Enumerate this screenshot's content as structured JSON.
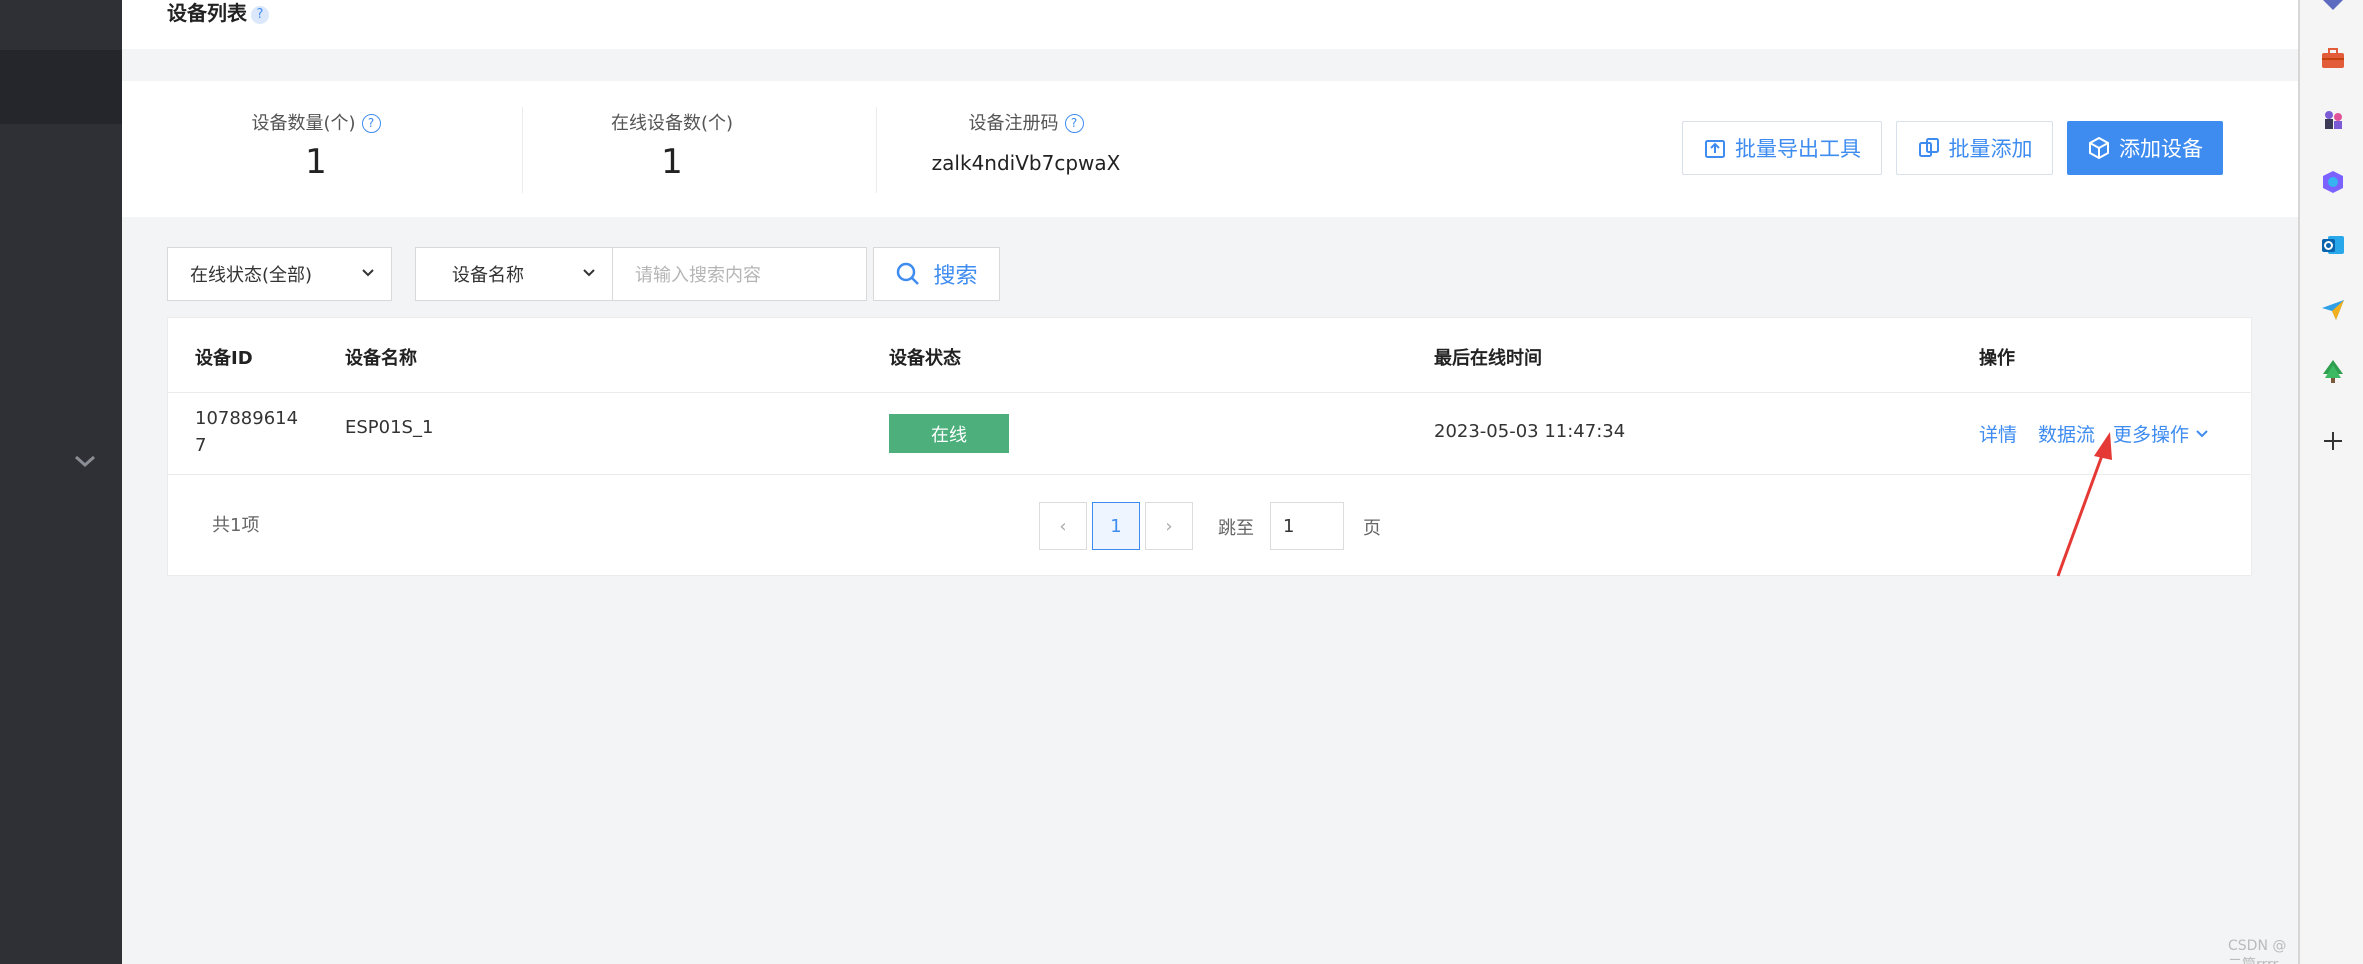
{
  "page": {
    "title": "设备列表",
    "title_help": "?"
  },
  "stats": [
    {
      "label": "设备数量(个)",
      "value": "1",
      "has_help": true
    },
    {
      "label": "在线设备数(个)",
      "value": "1",
      "has_help": false
    },
    {
      "label": "设备注册码",
      "value": "zalk4ndiVb7cpwaX",
      "has_help": true
    }
  ],
  "help_glyph": "?",
  "actions": {
    "export_tool": "批量导出工具",
    "batch_add": "批量添加",
    "add_device": "添加设备"
  },
  "filters": {
    "status_select": "在线状态(全部)",
    "field_select": "设备名称",
    "search_placeholder": "请输入搜索内容",
    "search_button": "搜索"
  },
  "table": {
    "columns": [
      "设备ID",
      "设备名称",
      "设备状态",
      "最后在线时间",
      "操作"
    ],
    "rows": [
      {
        "id_line1": "107889614",
        "id_line2": "7",
        "name": "ESP01S_1",
        "status": "在线",
        "last_online": "2023-05-03 11:47:34",
        "ops": [
          "详情",
          "数据流",
          "更多操作"
        ]
      }
    ]
  },
  "pagination": {
    "total": "共1项",
    "prev": "‹",
    "current_page": "1",
    "next": "›",
    "jump_label": "跳至",
    "jump_value": "1",
    "page_suffix": "页"
  },
  "watermark": "CSDN @二筒rrrr",
  "colors": {
    "primary": "#3f8cf0",
    "status_online": "#4caf7c",
    "sidebar": "#2e3036",
    "annotation_arrow": "#e53935"
  },
  "icons": {
    "float_panel": [
      "edit-icon",
      "headset-icon",
      "help-circle-icon",
      "user-icon"
    ],
    "right_sidebar": [
      "briefcase-icon",
      "chess-icon",
      "copilot-icon",
      "outlook-icon",
      "send-icon",
      "tree-icon",
      "plus-icon"
    ]
  }
}
